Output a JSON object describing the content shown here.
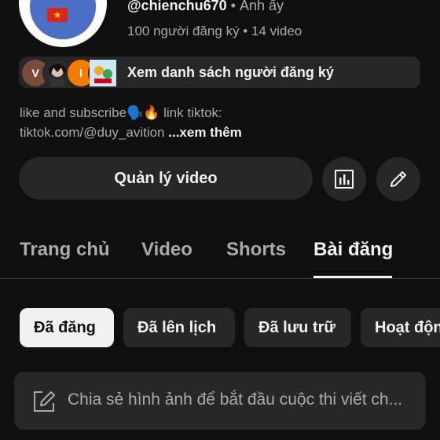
{
  "channel": {
    "handle": "@chienchu670",
    "separator": "•",
    "name": "Anh ấy",
    "stats": "100 người đăng ký • 14 video"
  },
  "subscribers_strip": {
    "avatars": [
      "V",
      "l"
    ],
    "label": "Xem danh sách người đăng ký"
  },
  "description": {
    "line1": "like and subscribe🗣️🔥 link tiktok:",
    "line2": "tiktok.com/@duy_avition",
    "more": "...xem thêm"
  },
  "actions": {
    "manage_label": "Quản lý video"
  },
  "tabs": [
    {
      "label": "Trang chủ",
      "active": false
    },
    {
      "label": "Video",
      "active": false
    },
    {
      "label": "Shorts",
      "active": false
    },
    {
      "label": "Bài đăng",
      "active": true
    }
  ],
  "chips": [
    {
      "label": "Đã đăng",
      "active": true
    },
    {
      "label": "Đã lên lịch",
      "active": false
    },
    {
      "label": "Đã lưu trữ",
      "active": false
    },
    {
      "label": "Hoạt động",
      "active": false
    }
  ],
  "composer": {
    "placeholder": "Chia sẻ hình ảnh để bắt đầu cuộc thi viết ch..."
  },
  "flag_star": "★",
  "colors": {
    "background": "#0f0f0f",
    "surface": "#272727",
    "text_primary": "#f1f1f1",
    "text_secondary": "#aaaaaa",
    "chip_active_bg": "#f1f1f1"
  }
}
